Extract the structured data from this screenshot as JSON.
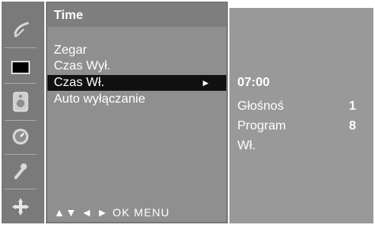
{
  "left_rail": {
    "icons": [
      "satellite-icon",
      "screen-icon",
      "speaker-icon",
      "clock-icon",
      "key-icon",
      "move-icon"
    ]
  },
  "menu": {
    "title": "Time",
    "items": [
      {
        "label": "Zegar",
        "selected": false
      },
      {
        "label": "Czas Wył.",
        "selected": false
      },
      {
        "label": "Czas Wł.",
        "selected": true,
        "arrow": "►"
      },
      {
        "label": "Auto wyłączanie",
        "selected": false
      }
    ],
    "footer": "▲▼ ◄ ► OK MENU"
  },
  "right_panel": {
    "time": "07:00",
    "rows": [
      {
        "label": "Głośnoś",
        "value": "1"
      },
      {
        "label": "Program",
        "value": "8"
      },
      {
        "label": "Wł.",
        "value": ""
      }
    ]
  },
  "colors": {
    "background": "#ffffff",
    "panel": "#8f8f8f",
    "selected": "#111111",
    "text": "#ffffff"
  }
}
